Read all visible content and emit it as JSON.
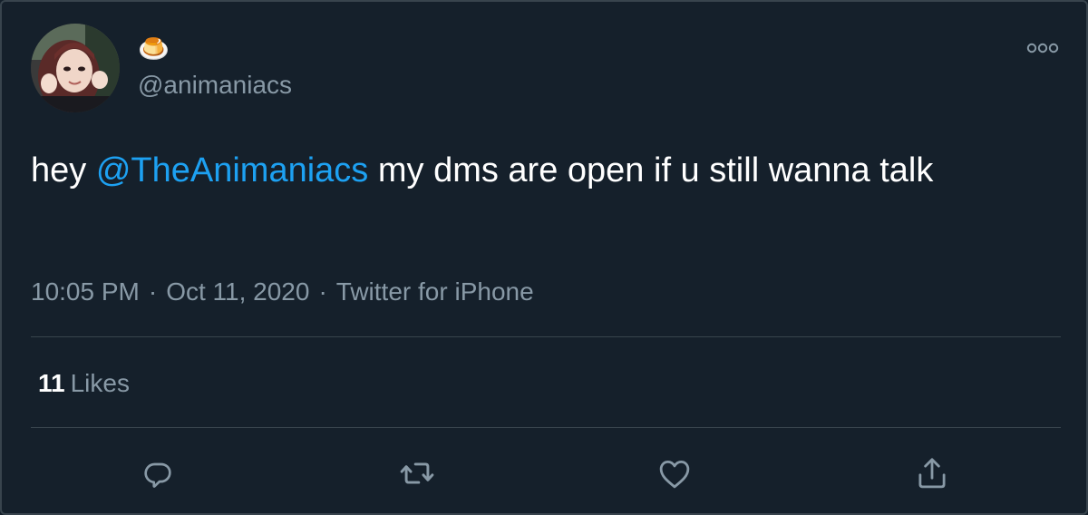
{
  "user": {
    "display_name": "🍮",
    "handle": "@animaniacs"
  },
  "tweet": {
    "text_before": "hey ",
    "mention": "@TheAnimaniacs",
    "text_after": " my dms are open if u still wanna talk",
    "time": "10:05 PM",
    "date": "Oct 11, 2020",
    "separator": "·",
    "source": "Twitter for iPhone"
  },
  "stats": {
    "likes_count": "11",
    "likes_label": "Likes"
  },
  "actions": {
    "reply_icon": "reply-icon",
    "retweet_icon": "retweet-icon",
    "like_icon": "heart-icon",
    "share_icon": "share-icon"
  },
  "colors": {
    "background": "#15202b",
    "accent": "#1da1f2",
    "secondary_text": "#8899a6",
    "border": "#38444d"
  }
}
